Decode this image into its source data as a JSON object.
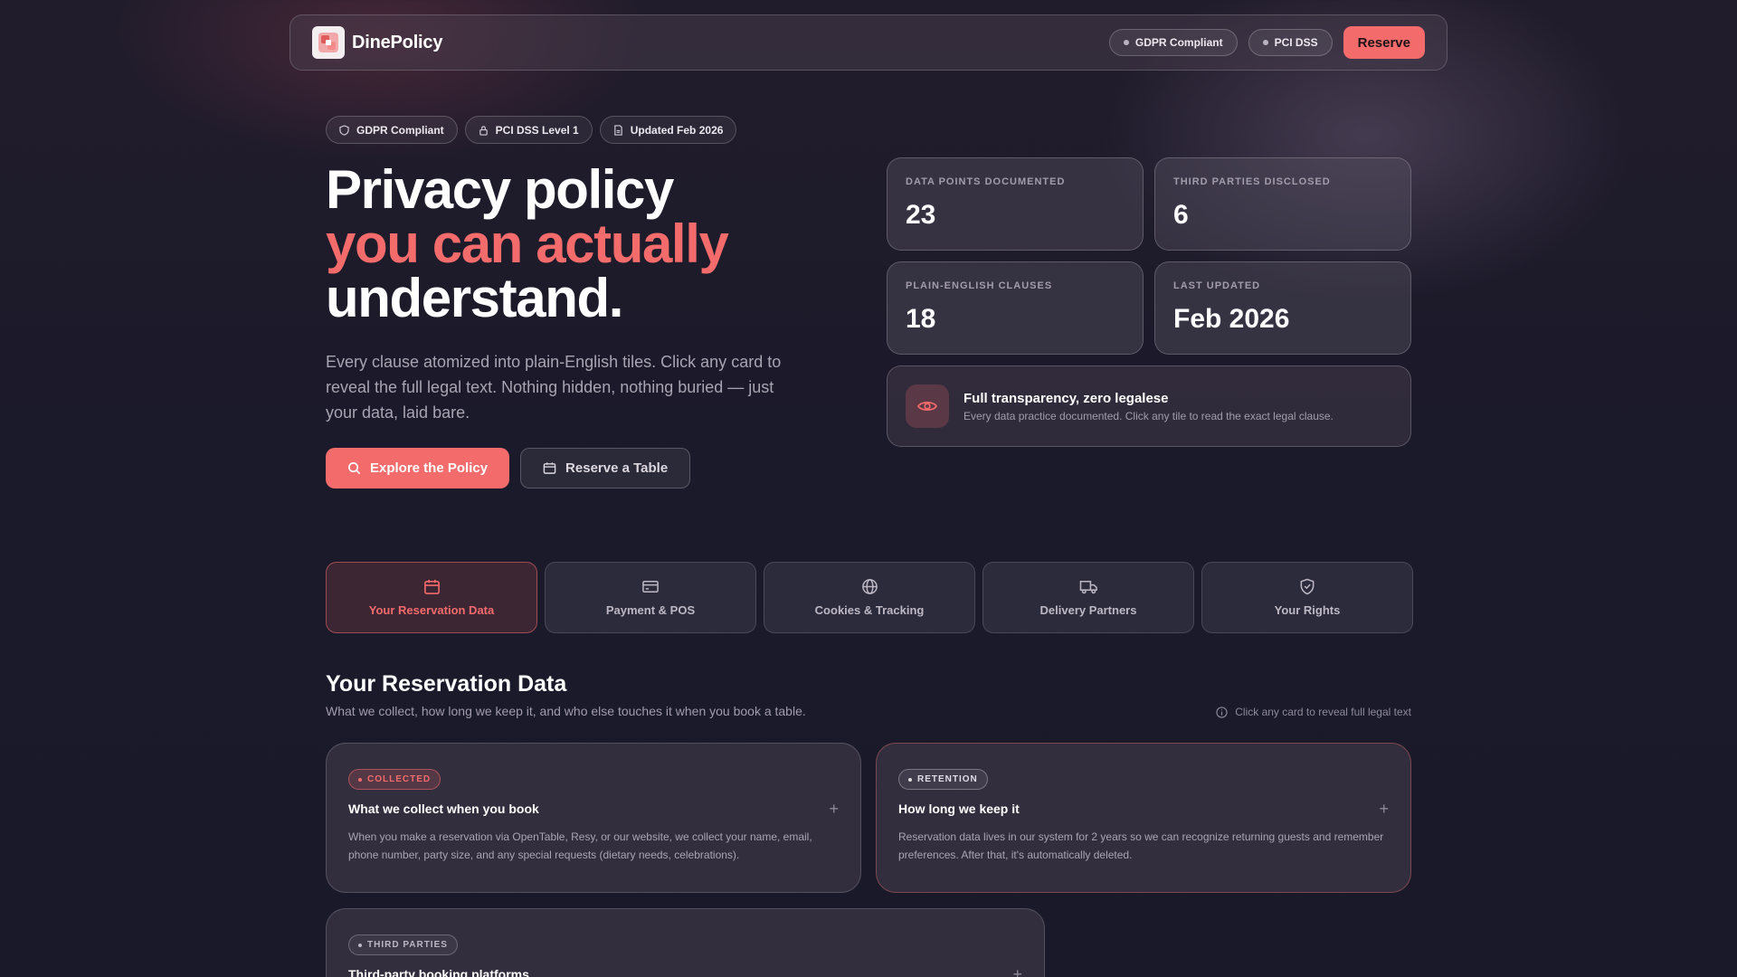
{
  "nav": {
    "brand": "DinePolicy",
    "pills": [
      "GDPR Compliant",
      "PCI DSS"
    ],
    "reserve_label": "Reserve"
  },
  "hero": {
    "badges": [
      {
        "label": "GDPR Compliant",
        "icon": "shield-icon"
      },
      {
        "label": "PCI DSS Level 1",
        "icon": "lock-icon"
      },
      {
        "label": "Updated Feb 2026",
        "icon": "document-icon"
      }
    ],
    "headline_line1": "Privacy policy",
    "headline_line2": "you can actually",
    "headline_line3": "understand.",
    "subtitle": "Every clause atomized into plain-English tiles. Click any card to reveal the full legal text. Nothing hidden, nothing buried — just your data, laid bare.",
    "cta_primary": "Explore the Policy",
    "cta_secondary": "Reserve a Table"
  },
  "stats": [
    {
      "label": "DATA POINTS DOCUMENTED",
      "value": "23"
    },
    {
      "label": "THIRD PARTIES DISCLOSED",
      "value": "6"
    },
    {
      "label": "PLAIN-ENGLISH CLAUSES",
      "value": "18"
    },
    {
      "label": "LAST UPDATED",
      "value": "Feb 2026"
    }
  ],
  "transparency": {
    "title": "Full transparency, zero legalese",
    "text": "Every data practice documented. Click any tile to read the exact legal clause."
  },
  "tabs": [
    {
      "label": "Your Reservation Data",
      "icon": "calendar-icon",
      "active": true
    },
    {
      "label": "Payment & POS",
      "icon": "credit-card-icon",
      "active": false
    },
    {
      "label": "Cookies & Tracking",
      "icon": "globe-icon",
      "active": false
    },
    {
      "label": "Delivery Partners",
      "icon": "truck-icon",
      "active": false
    },
    {
      "label": "Your Rights",
      "icon": "shield-check-icon",
      "active": false
    }
  ],
  "section": {
    "title": "Your Reservation Data",
    "subtitle": "What we collect, how long we keep it, and who else touches it when you book a table.",
    "hint": "Click any card to reveal full legal text"
  },
  "cards": [
    {
      "tag": "COLLECTED",
      "title": "What we collect when you book",
      "text": "When you make a reservation via OpenTable, Resy, or our website, we collect your name, email, phone number, party size, and any special requests (dietary needs, celebrations)."
    },
    {
      "tag": "RETENTION",
      "title": "How long we keep it",
      "text": "Reservation data lives in our system for 2 years so we can recognize returning guests and remember preferences. After that, it's automatically deleted."
    },
    {
      "tag": "THIRD PARTIES",
      "title": "Third-party booking platforms",
      "text": ""
    }
  ],
  "colors": {
    "accent": "#f36b6b",
    "background": "#1b1a2a"
  }
}
